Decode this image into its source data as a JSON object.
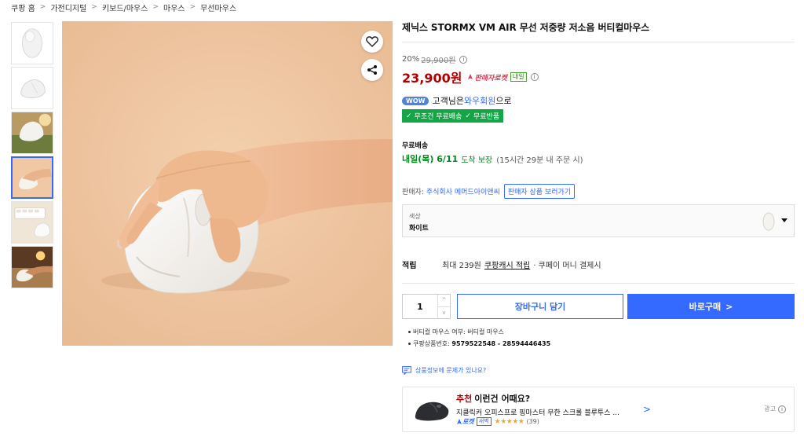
{
  "breadcrumb": [
    "쿠팡 홈",
    "가전디지털",
    "키보드/마우스",
    "마우스",
    "무선마우스"
  ],
  "breadcrumb_sep": ">",
  "thumbnails": [
    {
      "name": "thumb-mouse-top-view"
    },
    {
      "name": "thumb-mouse-side-view"
    },
    {
      "name": "thumb-mouse-field"
    },
    {
      "name": "thumb-mouse-hand",
      "selected": true
    },
    {
      "name": "thumb-mouse-desk"
    },
    {
      "name": "thumb-mouse-lifestyle"
    }
  ],
  "product": {
    "title": "제닉스 STORMX VM AIR 무선 저중량 저소음 버티컬마우스",
    "discount_rate": "20%",
    "original_price": "29,900원",
    "info_glyph": "i",
    "price": "23,900원",
    "seller_rocket": "판매자로켓",
    "naeil": "내일",
    "wow_badge": "WOW",
    "wow_prefix": "고객님은 ",
    "wow_link": "와우회원",
    "wow_suffix": "으로",
    "free_shipping": [
      "무조건 무료배송",
      "무료반품"
    ],
    "delivery_label": "무료배송",
    "delivery_date": "내일(목) 6/11",
    "delivery_guarantee": "도착 보장",
    "delivery_note": "(15시간 29분 내 주문 시)",
    "seller_label": "판매자:",
    "seller_name": "주식회사 메머드아이앤씨",
    "seller_button": "판매자 상품 보러가기",
    "option_label": "색상",
    "option_value": "화이트",
    "points_label": "적립",
    "points_text": "최대 239원",
    "points_link": "쿠팡캐시 적립",
    "points_suffix": "· 쿠페이 머니 결제시",
    "quantity": "1",
    "qty_up": "^",
    "qty_down": "v",
    "cart_button": "장바구니 담기",
    "buy_button": "바로구매",
    "buy_chevron": ">",
    "attributes": [
      {
        "label": "버티컬 마우스 여부:",
        "value": "버티컬 마우스"
      },
      {
        "label": "쿠팡상품번호:",
        "value": "9579522548 - 28594446435"
      }
    ],
    "report_link": "상품정보에 문제가 있나요?"
  },
  "recommendation": {
    "title_red": "추천",
    "title": "이런건 어때요?",
    "item_name": "지클릭커 오피스프로 핑마스터 무한 스크롤 블루투스 ...",
    "chevron": ">",
    "rocket": "로켓",
    "saebyeok": "새벽",
    "rating": 5,
    "stars": "★★★★★",
    "review_count": "(39)",
    "ad_label": "광고"
  },
  "colors": {
    "accent_blue": "#346aff",
    "price_red": "#ae0000",
    "free_ship_green": "#13a546",
    "delivery_green": "#00891a",
    "image_bg": "#f0c8a4"
  }
}
